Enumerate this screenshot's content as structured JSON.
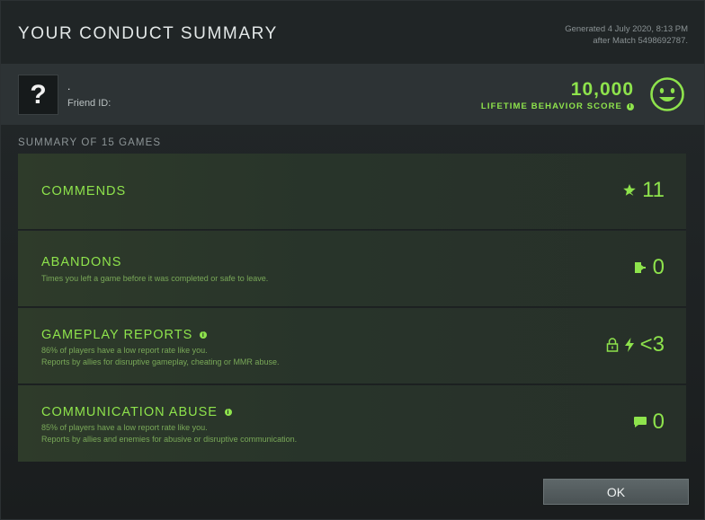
{
  "dialog": {
    "title": "YOUR CONDUCT SUMMARY",
    "generated_line1": "Generated 4 July 2020, 8:13 PM",
    "generated_line2": "after Match 5498692787."
  },
  "profile": {
    "avatar_glyph": "?",
    "player_name": ".",
    "friend_id_label": "Friend ID:",
    "score": "10,000",
    "score_label": "LIFETIME BEHAVIOR SCORE",
    "info_glyph": "i",
    "score_icon": "smiley-face-icon"
  },
  "summary": {
    "heading": "SUMMARY OF 15 GAMES",
    "rows": [
      {
        "title": "COMMENDS",
        "lines": [],
        "value": "11",
        "icons": [
          "star-commend-icon"
        ]
      },
      {
        "title": "ABANDONS",
        "lines": [
          "Times you left a game before it was completed or safe to leave."
        ],
        "value": "0",
        "icons": [
          "exit-door-icon"
        ]
      },
      {
        "title": "GAMEPLAY REPORTS",
        "lines": [
          "86% of players have a low report rate like you.",
          "Reports by allies for disruptive gameplay, cheating or MMR abuse."
        ],
        "value": "<3",
        "icons": [
          "lock-icon",
          "lightning-icon"
        ]
      },
      {
        "title": "COMMUNICATION ABUSE",
        "lines": [
          "85% of players have a low report rate like you.",
          "Reports by allies and enemies for abusive or disruptive communication."
        ],
        "value": "0",
        "icons": [
          "chat-bubble-icon"
        ]
      }
    ]
  },
  "footer": {
    "ok_label": "OK"
  },
  "colors": {
    "accent_green": "#8ee34c",
    "background": "#1c1f20",
    "row_green": "#2e3b2a"
  }
}
